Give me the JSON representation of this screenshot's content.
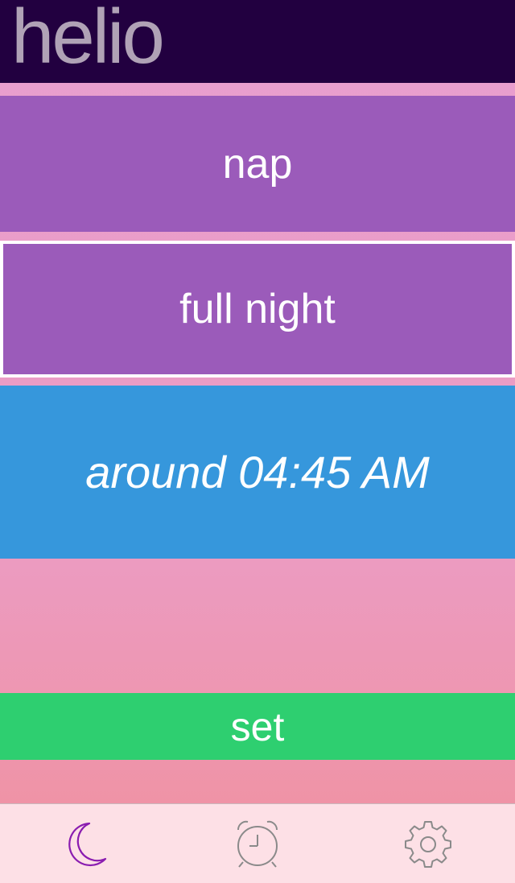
{
  "header": {
    "title": "helio"
  },
  "modes": {
    "nap_label": "nap",
    "full_night_label": "full night",
    "selected": "full night"
  },
  "wake_time": {
    "text": "around 04:45 AM"
  },
  "actions": {
    "set_label": "set"
  },
  "tabbar": {
    "tabs": [
      {
        "icon": "moon-icon",
        "active": true
      },
      {
        "icon": "alarm-clock-icon",
        "active": false
      },
      {
        "icon": "gear-icon",
        "active": false
      }
    ]
  },
  "colors": {
    "header_bg": "#220040",
    "mode_purple": "#9b5bba",
    "time_blue": "#3697dc",
    "set_green": "#2ecf70",
    "tab_active": "#8a1cb0",
    "tab_inactive": "#8a8a8a"
  }
}
